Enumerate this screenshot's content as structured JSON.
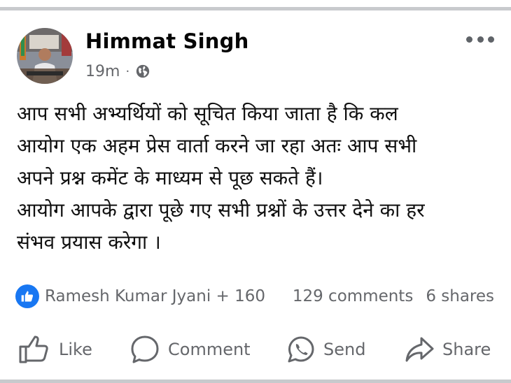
{
  "post": {
    "author": "Himmat Singh",
    "time": "19m",
    "separator": "·",
    "privacy_icon": "globe-icon",
    "more_icon": "more-options-icon",
    "text_lines": [
      "आप सभी अभ्यर्थियों को सूचित किया जाता है कि कल",
      "आयोग एक अहम प्रेस वार्ता करने जा रहा अतः आप सभी",
      "अपने प्रश्न कमेंट के माध्यम से पूछ सकते हैं।",
      "आयोग आपके द्वारा पूछे गए सभी प्रश्नों के उत्तर देने का हर",
      "संभव प्रयास करेगा ।"
    ]
  },
  "reactions": {
    "icon": "like-reaction-icon",
    "summary": "Ramesh Kumar Jyani + 160",
    "comments": "129 comments",
    "shares": "6 shares"
  },
  "actions": {
    "like": "Like",
    "comment": "Comment",
    "send": "Send",
    "share": "Share"
  },
  "colors": {
    "brand_blue": "#1877f2",
    "secondary_text": "#65676b",
    "divider": "#c8cacd"
  }
}
